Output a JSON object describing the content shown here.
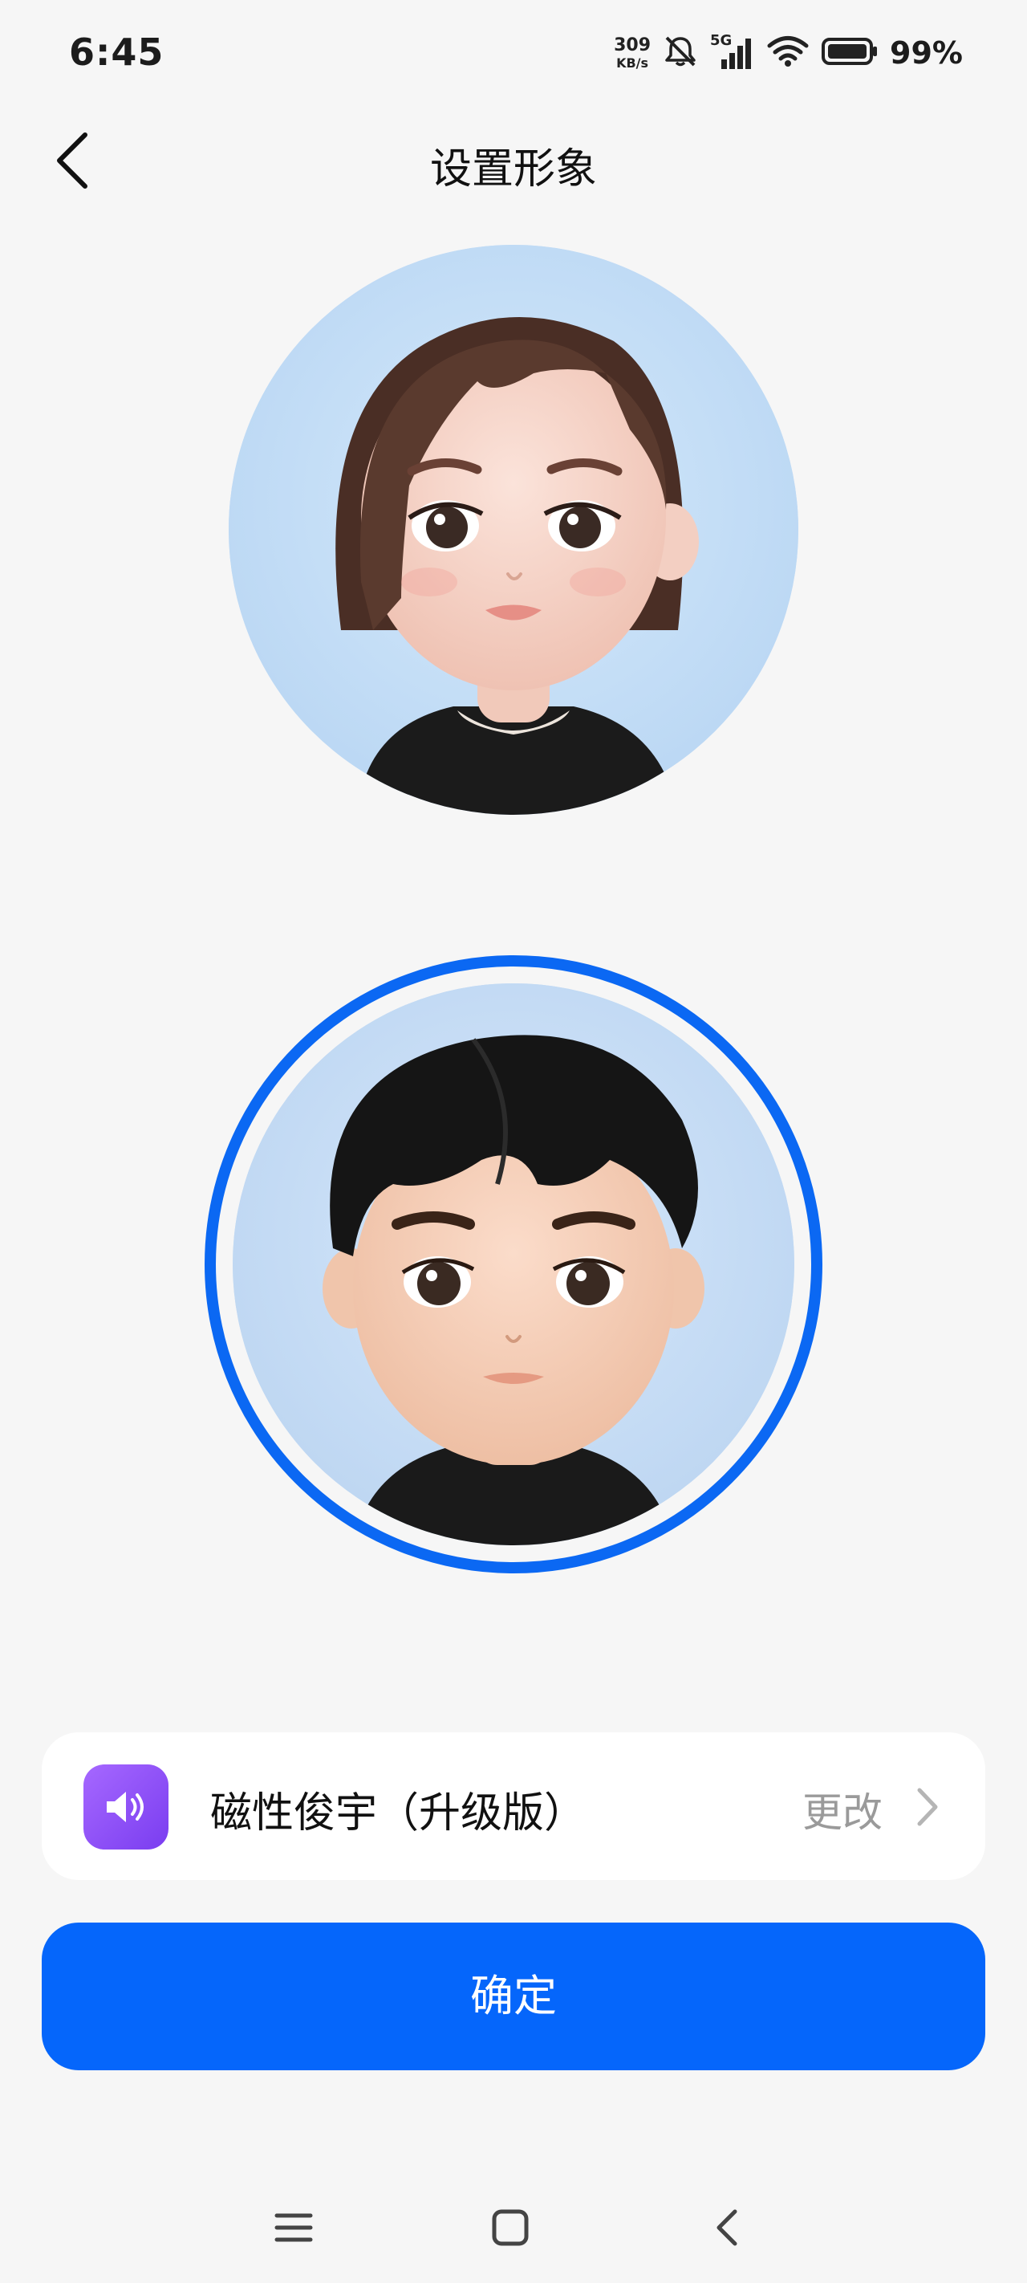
{
  "status_bar": {
    "time": "6:45",
    "net_speed_value": "309",
    "net_speed_unit": "KB/s",
    "network_type": "5G",
    "battery_percent": "99%",
    "icons": [
      "mute-icon",
      "signal-icon",
      "wifi-icon",
      "battery-icon"
    ]
  },
  "header": {
    "title": "设置形象",
    "back_icon": "chevron-left-icon"
  },
  "avatars": [
    {
      "name": "female-avatar",
      "selected": false
    },
    {
      "name": "male-avatar",
      "selected": true
    }
  ],
  "voice": {
    "icon": "speaker-icon",
    "name": "磁性俊宇（升级版）",
    "action_label": "更改",
    "chevron_icon": "chevron-right-icon"
  },
  "confirm": {
    "label": "确定"
  },
  "nav_bar": {
    "icons": [
      "menu-icon",
      "home-icon",
      "back-icon"
    ]
  },
  "colors": {
    "accent": "#0566fb",
    "background": "#f6f6f6",
    "voice_icon": "#8b4cf7"
  }
}
